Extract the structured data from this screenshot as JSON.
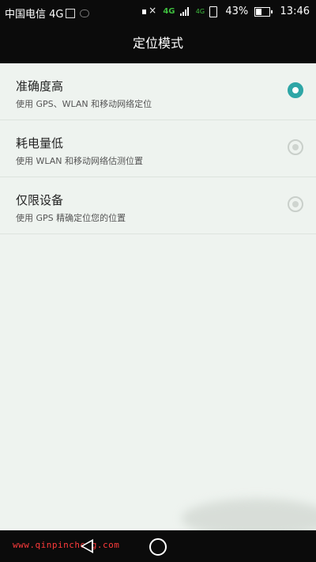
{
  "status_bar": {
    "carrier": "中国电信 4G",
    "network_type": "4G",
    "battery_percent": "43%",
    "time": "13:46",
    "icons": [
      "sim-icon",
      "sync-icon",
      "mute-icon",
      "signal-icon",
      "phone-icon",
      "battery-icon"
    ]
  },
  "title": "定位模式",
  "modes": [
    {
      "label": "准确度高",
      "description": "使用 GPS、WLAN 和移动网络定位",
      "selected": true
    },
    {
      "label": "耗电量低",
      "description": "使用 WLAN 和移动网络估测位置",
      "selected": false
    },
    {
      "label": "仅限设备",
      "description": "使用 GPS 精确定位您的位置",
      "selected": false
    }
  ],
  "watermark": "www.qinpincheng.com",
  "nav_icons": [
    "back-icon",
    "home-icon"
  ],
  "colors": {
    "accent": "#2ea6a6",
    "background": "#eef3ef",
    "bar": "#0b0b0b",
    "network_green": "#3fbf3f",
    "watermark": "#ff3b3b"
  }
}
